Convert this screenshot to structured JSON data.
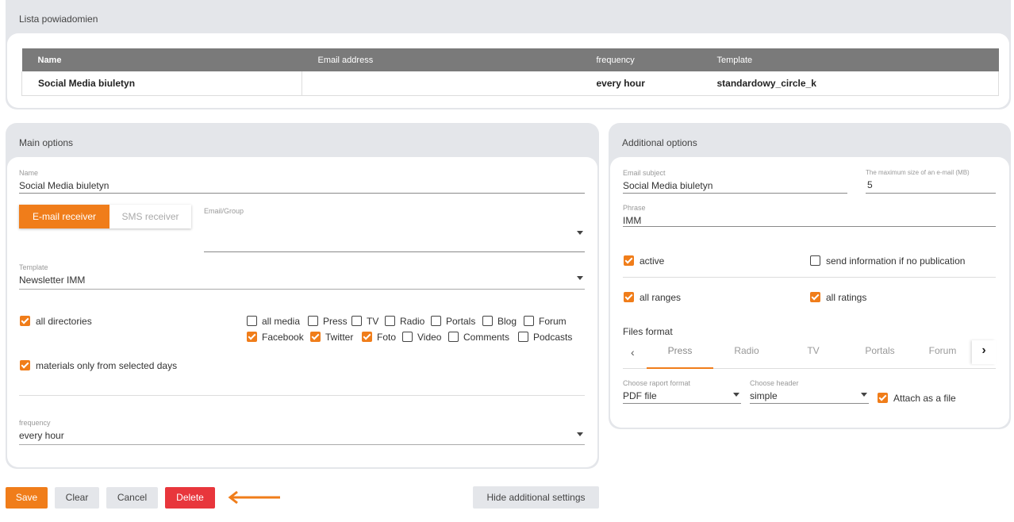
{
  "notifications": {
    "title": "Lista powiadomien",
    "columns": [
      "Name",
      "Email address",
      "frequency",
      "Template"
    ],
    "rows": [
      [
        "Social Media biuletyn",
        "",
        "every hour",
        "standardowy_circle_k"
      ]
    ]
  },
  "main": {
    "title": "Main options",
    "name_label": "Name",
    "name_value": "Social Media biuletyn",
    "receiver_tabs": [
      "E-mail receiver",
      "SMS receiver"
    ],
    "email_group_label": "Email/Group",
    "email_group_value": "",
    "template_label": "Template",
    "template_value": "Newsletter IMM",
    "all_directories": "all directories",
    "media": {
      "row1": [
        "all media",
        "Press",
        "TV",
        "Radio",
        "Portals",
        "Blog",
        "Forum"
      ],
      "row1_checked": [
        false,
        false,
        false,
        false,
        false,
        false,
        false
      ],
      "row2": [
        "Facebook",
        "Twitter",
        "Foto",
        "Video",
        "Comments",
        "Podcasts"
      ],
      "row2_checked": [
        true,
        true,
        true,
        false,
        false,
        false
      ]
    },
    "selected_days": "materials only from selected days",
    "frequency_label": "frequency",
    "frequency_value": "every hour"
  },
  "additional": {
    "title": "Additional options",
    "subject_label": "Email subject",
    "subject_value": "Social Media biuletyn",
    "maxsize_label": "The maximum size of an e-mail (MB)",
    "maxsize_value": "5",
    "phrase_label": "Phrase",
    "phrase_value": "IMM",
    "active": "active",
    "no_pub": "send information if no publication",
    "all_ranges": "all ranges",
    "all_ratings": "all ratings",
    "files_format": "Files format",
    "format_tabs": [
      "Press",
      "Radio",
      "TV",
      "Portals",
      "Forum"
    ],
    "report_label": "Choose raport format",
    "report_value": "PDF file",
    "header_label": "Choose header",
    "header_value": "simple",
    "attach": "Attach as a file"
  },
  "actions": {
    "save": "Save",
    "clear": "Clear",
    "cancel": "Cancel",
    "delete": "Delete",
    "hide": "Hide additional settings"
  },
  "colors": {
    "accent": "#f07d1a",
    "danger": "#e8363c",
    "header_gray": "#7a7a7a"
  }
}
